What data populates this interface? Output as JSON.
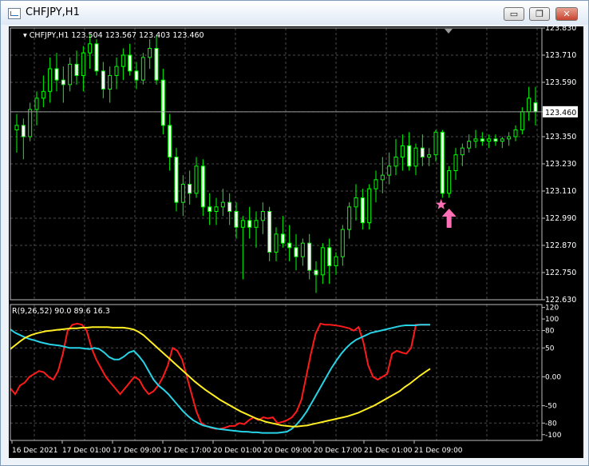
{
  "window": {
    "title": "CHFJPY,H1",
    "minimize_glyph": "▭",
    "restore_glyph": "❐",
    "close_glyph": "✕"
  },
  "colors": {
    "bull": "#00ff00",
    "bear": "#00ff00",
    "grid": "#4a4a4a",
    "text": "#ffffff",
    "red": "#ff1a1a",
    "cyan": "#27d3e6",
    "yellow": "#ffee22",
    "arrow": "#ff6fb5"
  },
  "price_panel": {
    "symbol_label": "CHFJPY,H1",
    "ohlc_label": "123.504 123.567 123.403 123.460",
    "current_price": "123.460"
  },
  "indicator_panel": {
    "label": "R(9,26,52) 90.0 89.6 16.3"
  },
  "chart_data": [
    {
      "type": "candlestick",
      "ylim": [
        122.63,
        123.83
      ],
      "y_ticks": [
        "123.830",
        "123.710",
        "123.590",
        "123.460",
        "123.350",
        "123.230",
        "123.110",
        "122.990",
        "122.870",
        "122.750",
        "122.630"
      ],
      "x_ticks": [
        "16 Dec 2021",
        "17 Dec 01:00",
        "17 Dec 09:00",
        "17 Dec 17:00",
        "20 Dec 01:00",
        "20 Dec 09:00",
        "20 Dec 17:00",
        "21 Dec 01:00",
        "21 Dec 09:00"
      ],
      "ohlc": [
        [
          123.38,
          123.45,
          123.28,
          123.4
        ],
        [
          123.4,
          123.43,
          123.25,
          123.35
        ],
        [
          123.35,
          123.5,
          123.33,
          123.47
        ],
        [
          123.47,
          123.55,
          123.4,
          123.52
        ],
        [
          123.52,
          123.62,
          123.48,
          123.55
        ],
        [
          123.55,
          123.7,
          123.5,
          123.65
        ],
        [
          123.65,
          123.72,
          123.55,
          123.6
        ],
        [
          123.6,
          123.66,
          123.5,
          123.58
        ],
        [
          123.58,
          123.7,
          123.55,
          123.67
        ],
        [
          123.67,
          123.73,
          123.58,
          123.62
        ],
        [
          123.62,
          123.75,
          123.55,
          123.72
        ],
        [
          123.72,
          123.8,
          123.65,
          123.76
        ],
        [
          123.76,
          123.78,
          123.62,
          123.64
        ],
        [
          123.64,
          123.68,
          123.52,
          123.56
        ],
        [
          123.56,
          123.66,
          123.5,
          123.62
        ],
        [
          123.62,
          123.7,
          123.56,
          123.66
        ],
        [
          123.66,
          123.74,
          123.6,
          123.71
        ],
        [
          123.71,
          123.76,
          123.62,
          123.64
        ],
        [
          123.64,
          123.68,
          123.56,
          123.6
        ],
        [
          123.6,
          123.72,
          123.58,
          123.7
        ],
        [
          123.7,
          123.78,
          123.65,
          123.74
        ],
        [
          123.74,
          123.8,
          123.58,
          123.6
        ],
        [
          123.6,
          123.65,
          123.36,
          123.4
        ],
        [
          123.4,
          123.45,
          123.2,
          123.26
        ],
        [
          123.26,
          123.3,
          123.02,
          123.06
        ],
        [
          123.06,
          123.18,
          123.0,
          123.14
        ],
        [
          123.14,
          123.2,
          123.05,
          123.1
        ],
        [
          123.1,
          123.26,
          123.08,
          123.22
        ],
        [
          123.22,
          123.25,
          123.0,
          123.04
        ],
        [
          123.04,
          123.1,
          122.96,
          123.02
        ],
        [
          123.02,
          123.08,
          122.96,
          123.04
        ],
        [
          123.04,
          123.12,
          123.0,
          123.06
        ],
        [
          123.06,
          123.1,
          122.96,
          123.02
        ],
        [
          123.02,
          123.06,
          122.9,
          122.95
        ],
        [
          122.95,
          123.0,
          122.72,
          122.98
        ],
        [
          122.98,
          123.04,
          122.9,
          122.95
        ],
        [
          122.95,
          123.02,
          122.86,
          122.98
        ],
        [
          122.98,
          123.06,
          122.92,
          123.02
        ],
        [
          123.02,
          123.04,
          122.8,
          122.84
        ],
        [
          122.84,
          122.95,
          122.8,
          122.92
        ],
        [
          122.92,
          123.0,
          122.86,
          122.88
        ],
        [
          122.88,
          122.96,
          122.8,
          122.86
        ],
        [
          122.86,
          122.92,
          122.76,
          122.82
        ],
        [
          122.82,
          122.9,
          122.78,
          122.88
        ],
        [
          122.88,
          122.92,
          122.72,
          122.76
        ],
        [
          122.76,
          122.8,
          122.66,
          122.74
        ],
        [
          122.74,
          122.88,
          122.7,
          122.86
        ],
        [
          122.86,
          122.9,
          122.7,
          122.78
        ],
        [
          122.78,
          122.84,
          122.74,
          122.82
        ],
        [
          122.82,
          122.96,
          122.78,
          122.94
        ],
        [
          122.94,
          123.06,
          122.9,
          123.04
        ],
        [
          123.04,
          123.14,
          122.98,
          123.08
        ],
        [
          123.08,
          123.12,
          122.94,
          122.97
        ],
        [
          122.97,
          123.14,
          122.94,
          123.12
        ],
        [
          123.12,
          123.2,
          123.06,
          123.16
        ],
        [
          123.16,
          123.26,
          123.1,
          123.18
        ],
        [
          123.18,
          123.28,
          123.14,
          123.22
        ],
        [
          123.22,
          123.34,
          123.18,
          123.26
        ],
        [
          123.26,
          123.36,
          123.2,
          123.31
        ],
        [
          123.31,
          123.37,
          123.2,
          123.22
        ],
        [
          123.22,
          123.32,
          123.18,
          123.3
        ],
        [
          123.3,
          123.36,
          123.22,
          123.26
        ],
        [
          123.26,
          123.3,
          123.22,
          123.27
        ],
        [
          123.27,
          123.38,
          123.24,
          123.37
        ],
        [
          123.37,
          123.38,
          123.08,
          123.1
        ],
        [
          123.1,
          123.22,
          123.08,
          123.2
        ],
        [
          123.2,
          123.3,
          123.16,
          123.27
        ],
        [
          123.27,
          123.32,
          123.22,
          123.3
        ],
        [
          123.3,
          123.36,
          123.28,
          123.33
        ],
        [
          123.33,
          123.38,
          123.3,
          123.34
        ],
        [
          123.34,
          123.37,
          123.31,
          123.33
        ],
        [
          123.33,
          123.36,
          123.3,
          123.34
        ],
        [
          123.34,
          123.36,
          123.31,
          123.33
        ],
        [
          123.33,
          123.35,
          123.3,
          123.34
        ],
        [
          123.34,
          123.37,
          123.31,
          123.35
        ],
        [
          123.35,
          123.4,
          123.33,
          123.38
        ],
        [
          123.38,
          123.48,
          123.36,
          123.46
        ],
        [
          123.46,
          123.57,
          123.42,
          123.52
        ],
        [
          123.5,
          123.57,
          123.4,
          123.46
        ]
      ],
      "arrow_index": 65,
      "arrow_price": 122.99,
      "star_price": 123.05
    },
    {
      "type": "line",
      "ylim": [
        -110,
        125
      ],
      "y_ticks": [
        {
          "label": "120",
          "v": 120
        },
        {
          "label": "100",
          "v": 100
        },
        {
          "label": "80",
          "v": 80
        },
        {
          "label": "50",
          "v": 50
        },
        {
          "label": "0.00",
          "v": 0
        },
        {
          "label": "-50",
          "v": -50
        },
        {
          "label": "-80",
          "v": -80
        },
        {
          "label": "-100",
          "v": -100
        }
      ],
      "series": [
        {
          "values": [
            -20,
            -30,
            -15,
            -10,
            0,
            5,
            10,
            8,
            0,
            -5,
            10,
            40,
            80,
            90,
            92,
            90,
            80,
            50,
            30,
            15,
            0,
            -10,
            -20,
            -30,
            -20,
            -10,
            0,
            -5,
            -20,
            -30,
            -25,
            -15,
            0,
            20,
            50,
            45,
            30,
            0,
            -30,
            -60,
            -80,
            -85,
            -88,
            -90,
            -90,
            -88,
            -85,
            -85,
            -80,
            -82,
            -75,
            -70,
            -75,
            -70,
            -72,
            -70,
            -80,
            -78,
            -75,
            -70,
            -60,
            -40,
            0,
            40,
            75,
            92,
            90,
            90,
            89,
            88,
            86,
            84,
            80,
            86,
            60,
            20,
            0,
            -5,
            0,
            5,
            40,
            45,
            42,
            40,
            50,
            90,
            90,
            90,
            90
          ]
        },
        {
          "values": [
            82,
            76,
            72,
            68,
            65,
            63,
            60,
            58,
            56,
            55,
            54,
            52,
            50,
            50,
            50,
            49,
            48,
            50,
            48,
            42,
            34,
            30,
            30,
            35,
            42,
            45,
            36,
            25,
            10,
            -5,
            -15,
            -22,
            -30,
            -40,
            -50,
            -60,
            -68,
            -75,
            -80,
            -84,
            -86,
            -88,
            -90,
            -91,
            -92,
            -93,
            -94,
            -95,
            -95,
            -96,
            -96,
            -97,
            -97,
            -97,
            -97,
            -96,
            -95,
            -90,
            -82,
            -72,
            -60,
            -45,
            -30,
            -15,
            0,
            15,
            28,
            40,
            50,
            58,
            64,
            68,
            72,
            76,
            78,
            80,
            82,
            84,
            86,
            88,
            89,
            89,
            89,
            90,
            90,
            90
          ]
        },
        {
          "values": [
            48,
            55,
            62,
            68,
            72,
            75,
            77,
            79,
            80,
            81,
            82,
            83,
            84,
            84,
            85,
            85,
            86,
            86,
            86,
            86,
            85,
            85,
            85,
            84,
            82,
            78,
            72,
            64,
            56,
            48,
            40,
            32,
            24,
            16,
            8,
            0,
            -8,
            -15,
            -22,
            -28,
            -34,
            -40,
            -45,
            -50,
            -55,
            -60,
            -64,
            -68,
            -72,
            -75,
            -78,
            -80,
            -82,
            -84,
            -85,
            -86,
            -86,
            -85,
            -84,
            -82,
            -80,
            -78,
            -76,
            -74,
            -72,
            -70,
            -68,
            -65,
            -62,
            -58,
            -54,
            -50,
            -45,
            -40,
            -35,
            -30,
            -25,
            -18,
            -12,
            -5,
            2,
            8,
            14
          ]
        }
      ]
    }
  ]
}
